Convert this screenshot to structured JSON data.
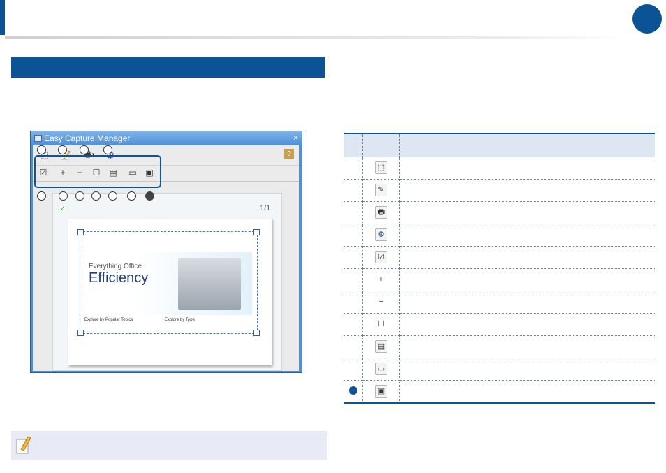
{
  "window": {
    "title": "Easy Capture Manager",
    "close_glyph": "×",
    "page_counter": "1/1"
  },
  "toolbar_top": [
    {
      "name": "capture-area-icon",
      "glyph": "⬚"
    },
    {
      "name": "notepad-icon",
      "glyph": "📝"
    },
    {
      "name": "print-icon",
      "glyph": "🖶▾"
    },
    {
      "name": "settings-gear-icon",
      "glyph": "⚙"
    },
    {
      "name": "help-icon",
      "glyph": "?"
    }
  ],
  "toolbar_bottom": [
    {
      "name": "checkbox-icon",
      "glyph": "☑"
    },
    {
      "name": "zoom-in-icon",
      "glyph": "+"
    },
    {
      "name": "zoom-out-icon",
      "glyph": "−"
    },
    {
      "name": "fit-page-icon",
      "glyph": "☐"
    },
    {
      "name": "page-setup-icon",
      "glyph": "▤"
    },
    {
      "name": "open-folder-icon",
      "glyph": "▭"
    },
    {
      "name": "save-icon",
      "glyph": "▣"
    }
  ],
  "preview": {
    "hero_line1": "Everything Office",
    "hero_line2": "Efficiency",
    "section_left": "Explore by Popular Topics",
    "section_right": "Explore by Type"
  },
  "table": {
    "rows": [
      {
        "icon": "capture-area-icon",
        "glyph": "⬚"
      },
      {
        "icon": "notepad-icon",
        "glyph": "✎"
      },
      {
        "icon": "print-icon",
        "glyph": "🖶"
      },
      {
        "icon": "settings-gear-icon",
        "glyph": "⚙"
      },
      {
        "icon": "checkbox-icon",
        "glyph": "☑"
      },
      {
        "icon": "zoom-in-icon",
        "glyph": "+"
      },
      {
        "icon": "zoom-out-icon",
        "glyph": "−"
      },
      {
        "icon": "fit-page-icon",
        "glyph": "☐"
      },
      {
        "icon": "page-setup-icon",
        "glyph": "▤"
      },
      {
        "icon": "open-folder-icon",
        "glyph": "▭"
      },
      {
        "icon": "save-icon",
        "glyph": "▣"
      }
    ]
  },
  "colors": {
    "brand_blue": "#0b5394",
    "table_header_bg": "#dde6f2",
    "note_bg": "#e8ebf6"
  }
}
